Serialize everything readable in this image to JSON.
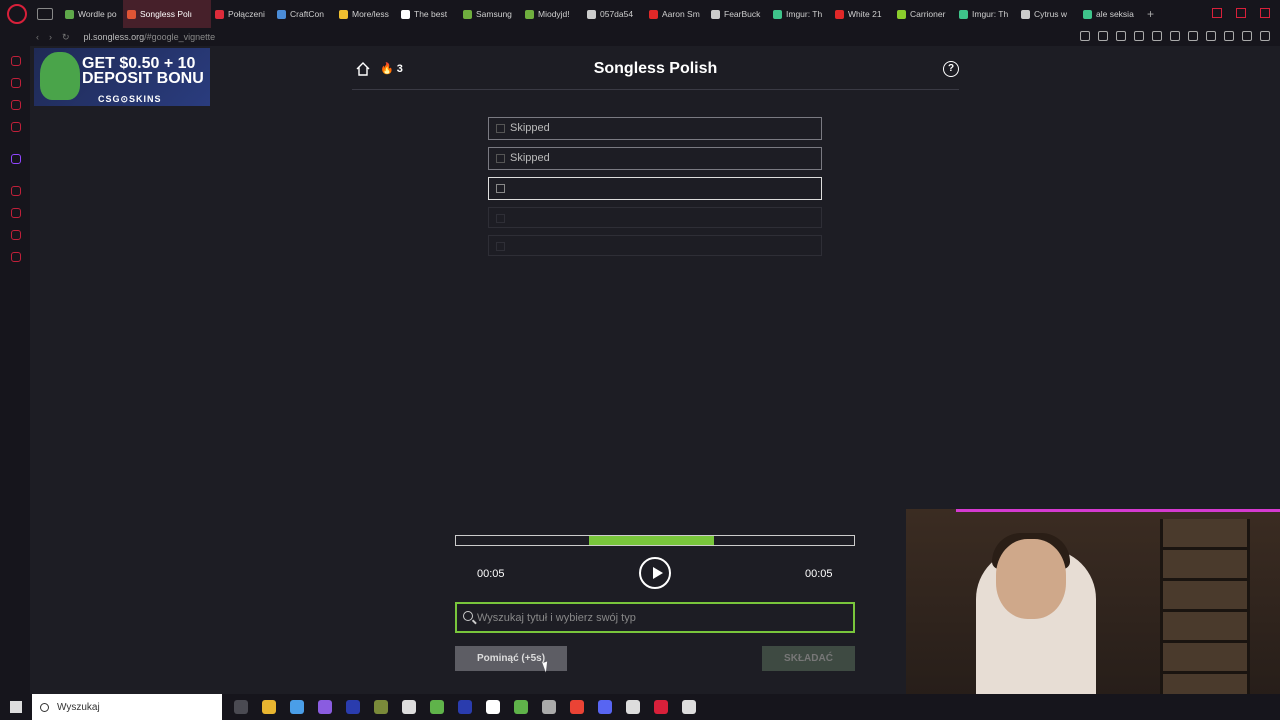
{
  "browser": {
    "tabs": [
      {
        "label": "Wordle po",
        "color": "#5fa84a"
      },
      {
        "label": "Songless Polı",
        "color": "#e05535",
        "active": true
      },
      {
        "label": "Połączeni",
        "color": "#dd2b3a"
      },
      {
        "label": "CraftCon",
        "color": "#4a8cd8"
      },
      {
        "label": "More/less",
        "color": "#f0c030"
      },
      {
        "label": "The best",
        "color": "#ffffff"
      },
      {
        "label": "Samsung",
        "color": "#6fae3e"
      },
      {
        "label": "Miodyjd!",
        "color": "#6fae3e"
      },
      {
        "label": "057da54",
        "color": "#cccccc"
      },
      {
        "label": "Aaron Sm",
        "color": "#e02828"
      },
      {
        "label": "FearBuck",
        "color": "#cccccc"
      },
      {
        "label": "Imgur: Th",
        "color": "#3ec48a"
      },
      {
        "label": "White 21",
        "color": "#e02828"
      },
      {
        "label": "Carrioner",
        "color": "#8acd2c"
      },
      {
        "label": "Imgur: Th",
        "color": "#3ec48a"
      },
      {
        "label": "Cytrus w",
        "color": "#cccccc"
      },
      {
        "label": "ale seksia",
        "color": "#3ec48a"
      }
    ],
    "url_host": "pl.songless.org",
    "url_path": "/#google_vignette"
  },
  "ad": {
    "line1": "GET $0.50 + 10",
    "line2": "DEPOSIT BONU",
    "brand": "CSG⊙SKINS"
  },
  "game": {
    "title": "Songless Polish",
    "streak_icon": "🔥",
    "streak": "3",
    "help": "?",
    "guesses": [
      {
        "text": "Skipped",
        "state": "skipped"
      },
      {
        "text": "Skipped",
        "state": "skipped"
      },
      {
        "text": "",
        "state": "current"
      },
      {
        "text": "",
        "state": "empty"
      },
      {
        "text": "",
        "state": "empty"
      }
    ],
    "progress": {
      "segment_start_fraction": 0.335,
      "segment_end_fraction": 0.648
    },
    "time_left": "00:05",
    "time_right": "00:05",
    "search_placeholder": "Wyszukaj tytuł i wybierz swój typ",
    "skip_label": "Pominąć (+5s)",
    "submit_label": "SKŁADAĆ",
    "accent": "#79c63c"
  },
  "taskbar": {
    "search_label": "Wyszukaj",
    "apps": [
      "#4a4a52",
      "#e8b530",
      "#4a9ee8",
      "#8a5ce0",
      "#2a3cae",
      "#7a8a3a",
      "#ddd",
      "#5fb34a",
      "#2a3cae",
      "#fff",
      "#5fb34a",
      "#aaa",
      "#ea4335",
      "#5865f2",
      "#ddd",
      "#d8203a",
      "#ddd"
    ]
  }
}
